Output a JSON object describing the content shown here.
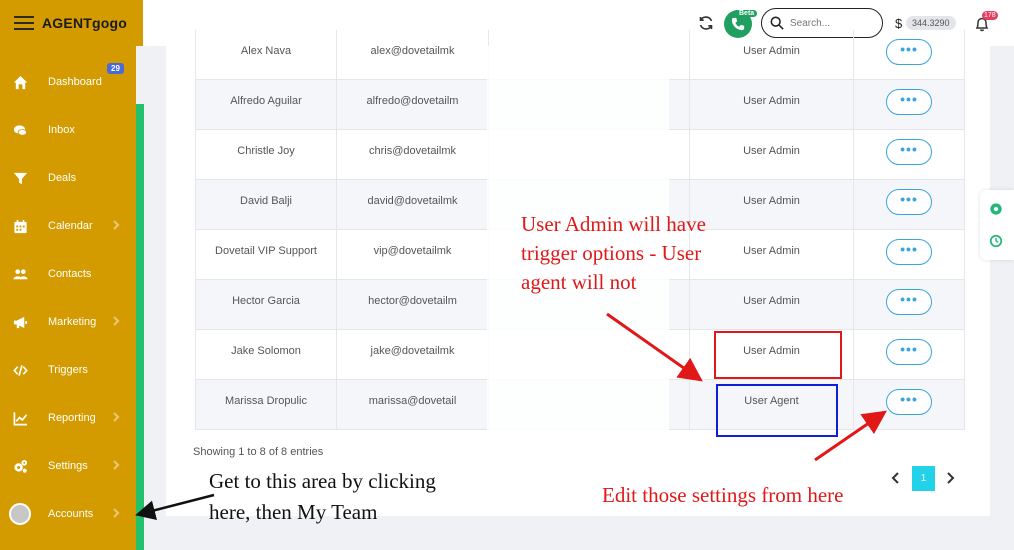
{
  "brand": {
    "logo": "AGENTgogo"
  },
  "sidebar": {
    "items": [
      {
        "label": "Dashboard",
        "icon": "home-icon",
        "chevron": false
      },
      {
        "label": "Inbox",
        "icon": "chat-icon",
        "chevron": false,
        "badge": "29"
      },
      {
        "label": "Deals",
        "icon": "filter-icon",
        "chevron": false
      },
      {
        "label": "Calendar",
        "icon": "calendar-icon",
        "chevron": true
      },
      {
        "label": "Contacts",
        "icon": "users-icon",
        "chevron": false
      },
      {
        "label": "Marketing",
        "icon": "megaphone-icon",
        "chevron": true
      },
      {
        "label": "Triggers",
        "icon": "code-icon",
        "chevron": false
      },
      {
        "label": "Reporting",
        "icon": "chart-icon",
        "chevron": true
      },
      {
        "label": "Settings",
        "icon": "gears-icon",
        "chevron": true
      },
      {
        "label": "Accounts",
        "icon": "avatar",
        "chevron": true
      }
    ]
  },
  "topbar": {
    "beta_label": "Beta",
    "search_placeholder": "Search...",
    "currency": "$",
    "balance": "344.3290",
    "notifications": "178"
  },
  "table": {
    "rows": [
      {
        "name": "Alex Nava",
        "email": "alex@dovetailmk",
        "role": "User Admin",
        "action": "•••"
      },
      {
        "name": "Alfredo Aguilar",
        "email": "alfredo@dovetailm",
        "role": "User Admin",
        "action": "•••"
      },
      {
        "name": "Christle Joy",
        "email": "chris@dovetailmk",
        "role": "User Admin",
        "action": "•••"
      },
      {
        "name": "David Balji",
        "email": "david@dovetailmk",
        "role": "User Admin",
        "action": "•••"
      },
      {
        "name": "Dovetail VIP Support",
        "email": "vip@dovetailmk",
        "role": "User Admin",
        "action": "•••"
      },
      {
        "name": "Hector Garcia",
        "email": "hector@dovetailm",
        "role": "User Admin",
        "action": "•••"
      },
      {
        "name": "Jake Solomon",
        "email": "jake@dovetailmk",
        "role": "User Admin",
        "action": "•••"
      },
      {
        "name": "Marissa Dropulic",
        "email": "marissa@dovetail",
        "role": "User Agent",
        "action": "•••"
      }
    ],
    "showing": "Showing 1 to 8 of 8 entries",
    "current_page": "1"
  },
  "annotations": {
    "role_note_1": "User Admin will have",
    "role_note_2": "trigger options - User",
    "role_note_3": "agent will not",
    "edit_note": "Edit those settings from here",
    "nav_note_1": "Get to this area by clicking",
    "nav_note_2": "here, then My Team"
  },
  "colors": {
    "sidebar": "#d39b00",
    "accent_green": "#23c06d",
    "action_blue": "#3aa5dd",
    "pager_cyan": "#22d2e8",
    "annotation_red": "#e01818",
    "annotation_blue": "#1020d8"
  }
}
